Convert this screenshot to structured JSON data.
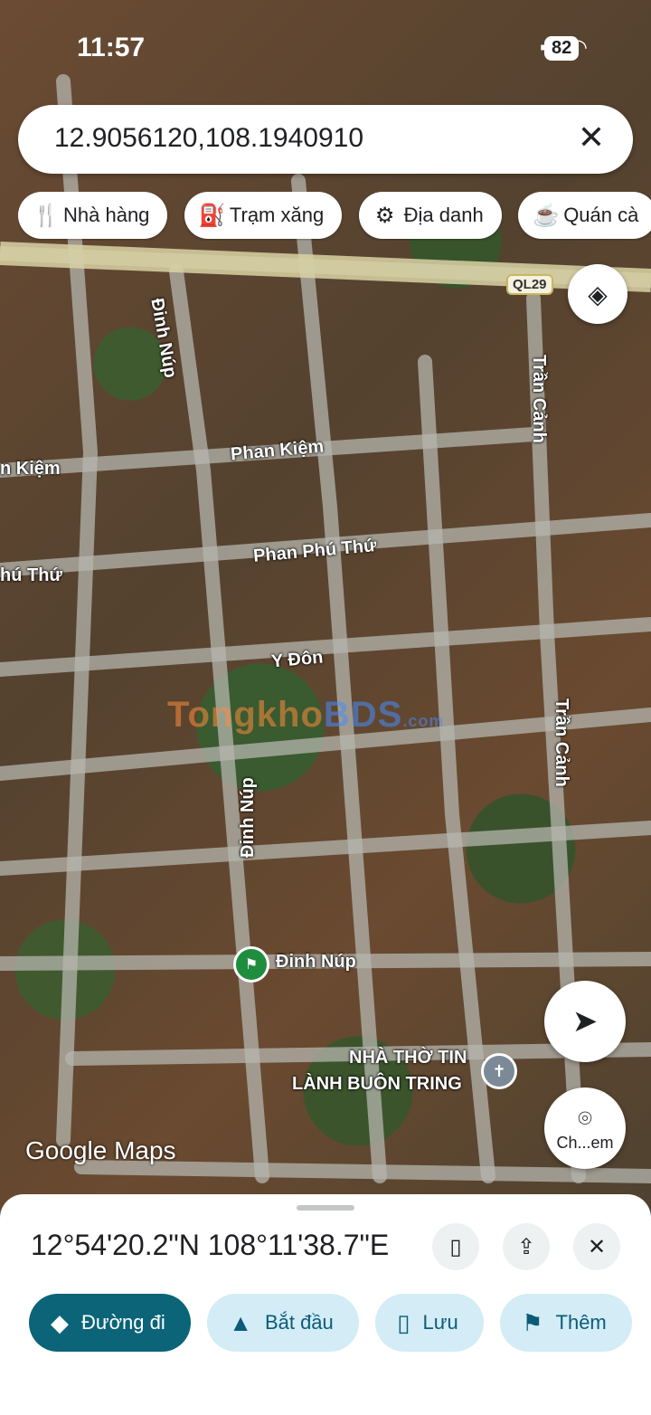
{
  "status": {
    "time": "11:57",
    "battery": "82"
  },
  "search": {
    "query": "12.9056120,108.1940910"
  },
  "chips": [
    {
      "icon": "restaurant-icon",
      "label": "Nhà hàng"
    },
    {
      "icon": "gas-station-icon",
      "label": "Trạm xăng"
    },
    {
      "icon": "attraction-icon",
      "label": "Địa danh"
    },
    {
      "icon": "coffee-icon",
      "label": "Quán cà"
    }
  ],
  "map": {
    "highway_badge": "QL29",
    "streets": {
      "dinh_nup_north": "Đinh Núp",
      "dinh_nup_south": "Đinh Núp",
      "phan_kiem": "Phan Kiệm",
      "phan_kiem_left": "n Kiệm",
      "phan_phu_thu": "Phan Phú Thứ",
      "phan_phu_thu_left": "hú Thứ",
      "y_don": "Y Đôn",
      "tran_canh_north": "Trần Cảnh",
      "tran_canh_south": "Trần Cảnh"
    },
    "pin_label": "Đinh Núp",
    "church_label_line1": "NHÀ THỜ TIN",
    "church_label_line2": "LÀNH BUÔN TRING",
    "watermark_a": "Tongkho",
    "watermark_b": "BDS",
    "watermark_c": ".com",
    "attribution": "Google Maps",
    "lens_label": "Ch...em"
  },
  "sheet": {
    "coords": "12°54'20.2\"N 108°11'38.7\"E",
    "actions": [
      {
        "icon": "directions-icon",
        "label": "Đường đi"
      },
      {
        "icon": "navigation-icon",
        "label": "Bắt đầu"
      },
      {
        "icon": "bookmark-icon",
        "label": "Lưu"
      },
      {
        "icon": "flag-icon",
        "label": "Thêm"
      }
    ]
  }
}
